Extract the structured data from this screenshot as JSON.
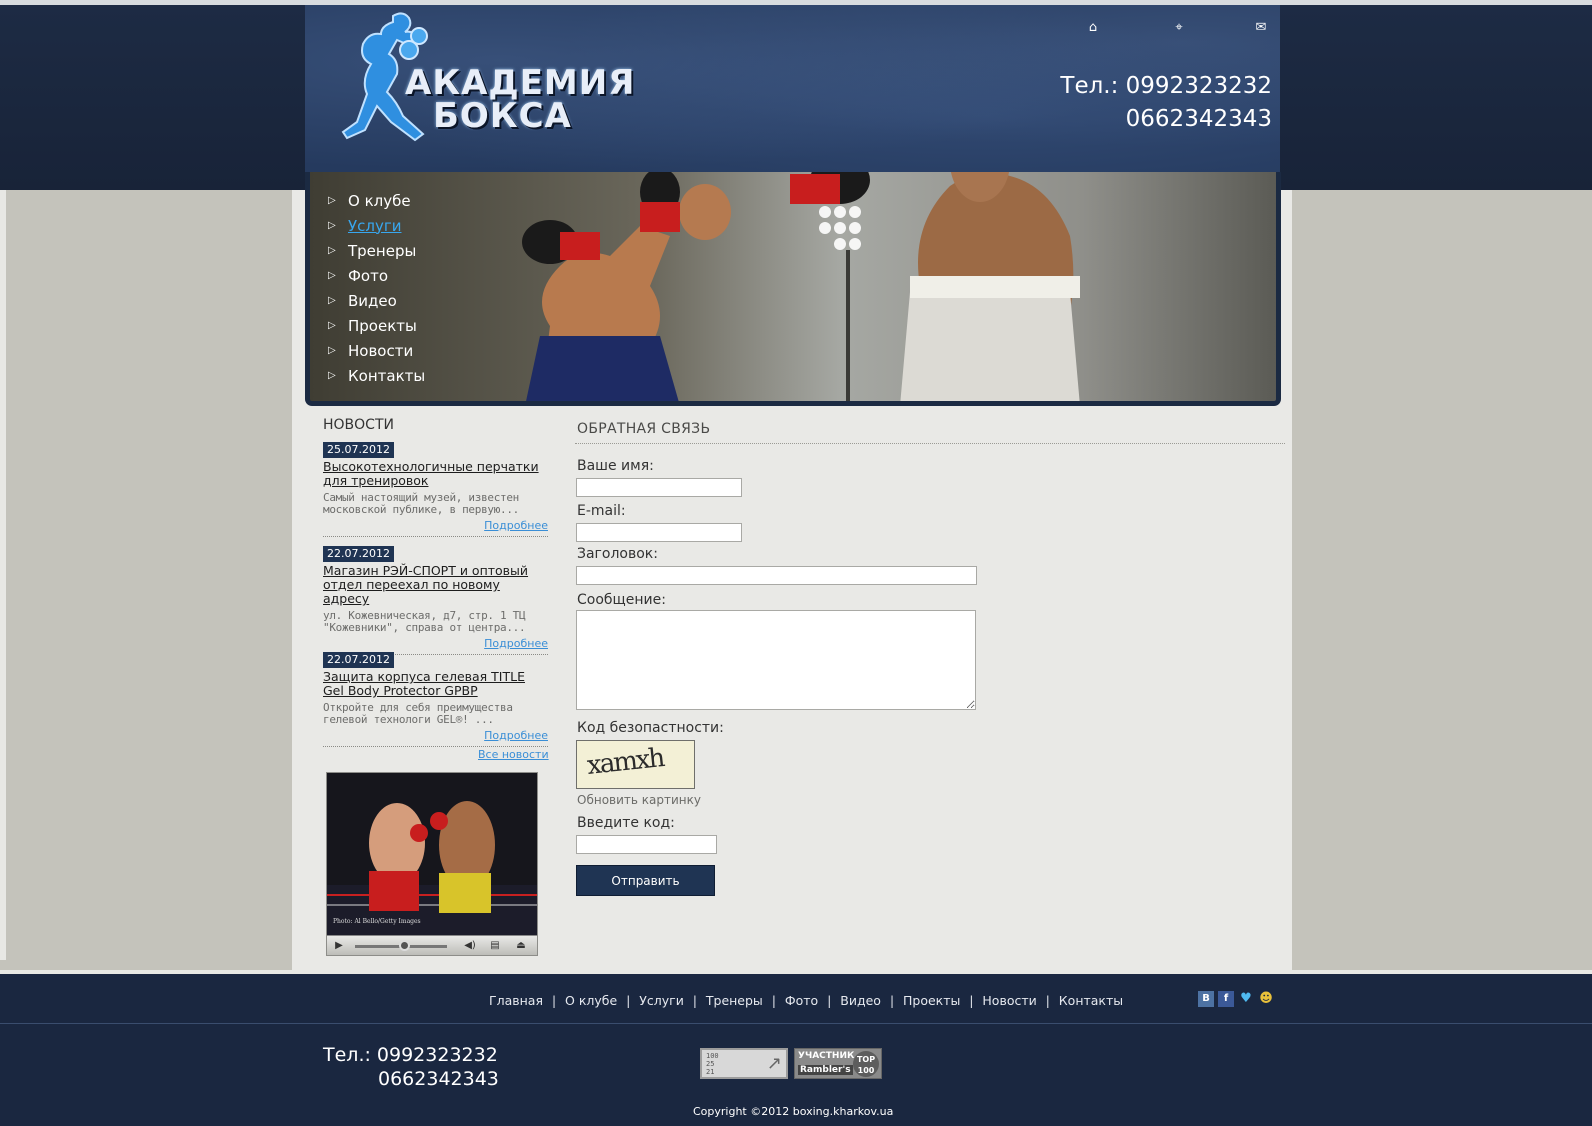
{
  "header": {
    "logo_line1": "АКАДЕМИЯ",
    "logo_line2": "БОКСА",
    "phone_label": "Тел.: 0992323232",
    "phone_2": "0662342343",
    "icons": [
      "home-icon",
      "sitemap-icon",
      "mail-icon"
    ]
  },
  "menu": {
    "items": [
      {
        "label": "О клубе"
      },
      {
        "label": "Услуги"
      },
      {
        "label": "Тренеры"
      },
      {
        "label": "Фото"
      },
      {
        "label": "Видео"
      },
      {
        "label": "Проекты"
      },
      {
        "label": "Новости"
      },
      {
        "label": "Контакты"
      }
    ],
    "active_index": 1,
    "active_color": "#38a7ef"
  },
  "news": {
    "title": "НОВОСТИ",
    "items": [
      {
        "date": "25.07.2012",
        "heading": "Высокотехнологичные перчатки для тренировок",
        "snippet": "Самый настоящий музей, известен московской публике, в первую...",
        "more": "Подробнее"
      },
      {
        "date": "22.07.2012",
        "heading": "Магазин РЭЙ-СПОРТ и оптовый отдел переехал по новому адресу",
        "snippet": "ул. Кожевническая, д7, стр. 1 ТЦ \"Кожевники\", справа от центра...",
        "more": "Подробнее"
      },
      {
        "date": "22.07.2012",
        "heading": "Защита корпуса гелевая TITLE Gel Body Protector GPBP",
        "snippet": "Откройте для себя преимущества гелевой технологи GEL®! ...",
        "more": "Подробнее"
      }
    ],
    "all_news": "Все новости"
  },
  "video": {
    "caption": "Photo: Al Bello/Getty Images"
  },
  "form": {
    "title": "ОБРАТНАЯ СВЯЗЬ",
    "name_label": "Ваше имя:",
    "email_label": "E-mail:",
    "subject_label": "Заголовок:",
    "message_label": "Сообщение:",
    "captcha_label": "Код безопастности:",
    "captcha_text": "xamxh",
    "refresh_label": "Обновить картинку",
    "code_label": "Введите код:",
    "submit_label": "Отправить"
  },
  "footer": {
    "nav": [
      "Главная",
      "О клубе",
      "Услуги",
      "Тренеры",
      "Фото",
      "Видео",
      "Проекты",
      "Новости",
      "Контакты"
    ],
    "socials": [
      "vkontakte-icon",
      "facebook-icon",
      "twitter-icon",
      "people-icon"
    ],
    "phone_label": "Тел.: 0992323232",
    "phone_2": "0662342343",
    "counter1_text": "100\n25\n21",
    "counter2_line1": "УЧАСТНИК",
    "counter2_line2": "Rambler's",
    "counter2_badge": "TOP 100",
    "copyright": "Copyright ©2012 boxing.kharkov.ua"
  },
  "colors": {
    "header_bg": "#1d2b44",
    "accent_link": "#3a8ed6",
    "button_bg": "#1f3453"
  }
}
